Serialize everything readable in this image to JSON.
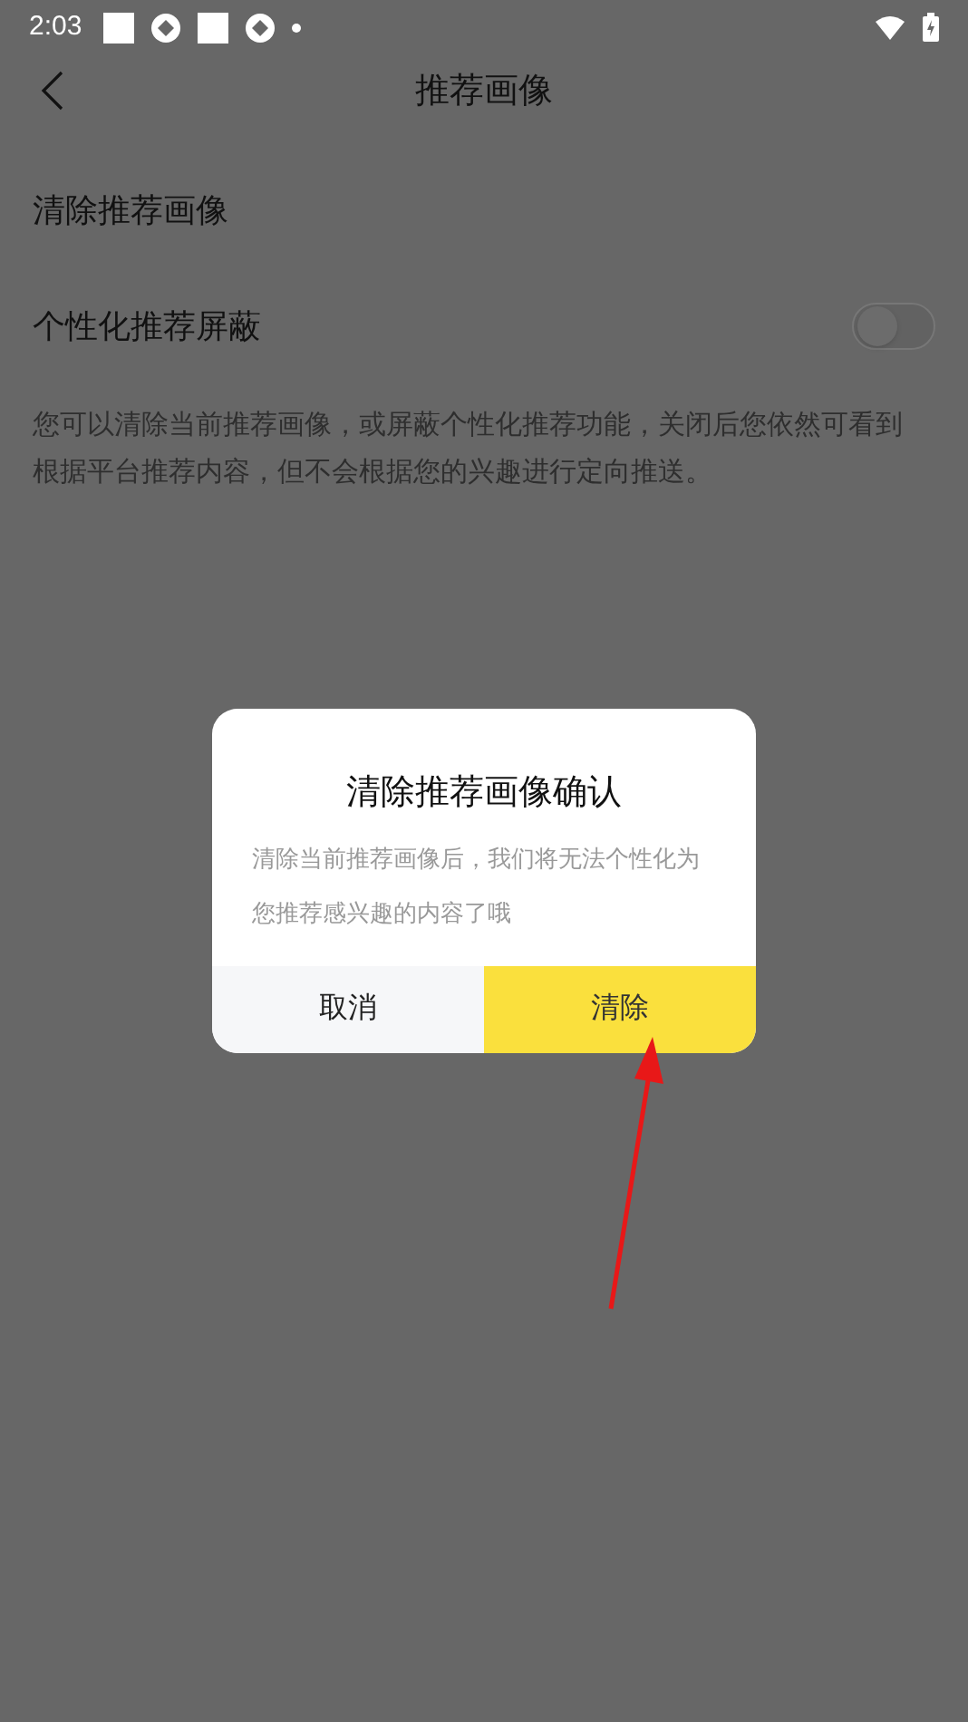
{
  "status_bar": {
    "time": "2:03"
  },
  "header": {
    "title": "推荐画像"
  },
  "settings": [
    {
      "kind": "link",
      "label": "清除推荐画像"
    },
    {
      "kind": "toggle",
      "label": "个性化推荐屏蔽",
      "on": false
    }
  ],
  "description": "您可以清除当前推荐画像，或屏蔽个性化推荐功能，关闭后您依然可看到根据平台推荐内容，但不会根据您的兴趣进行定向推送。",
  "dialog": {
    "title": "清除推荐画像确认",
    "message": "清除当前推荐画像后，我们将无法个性化为您推荐感兴趣的内容了哦",
    "buttons": [
      {
        "label": "取消",
        "primary": false
      },
      {
        "label": "清除",
        "primary": true
      }
    ]
  }
}
